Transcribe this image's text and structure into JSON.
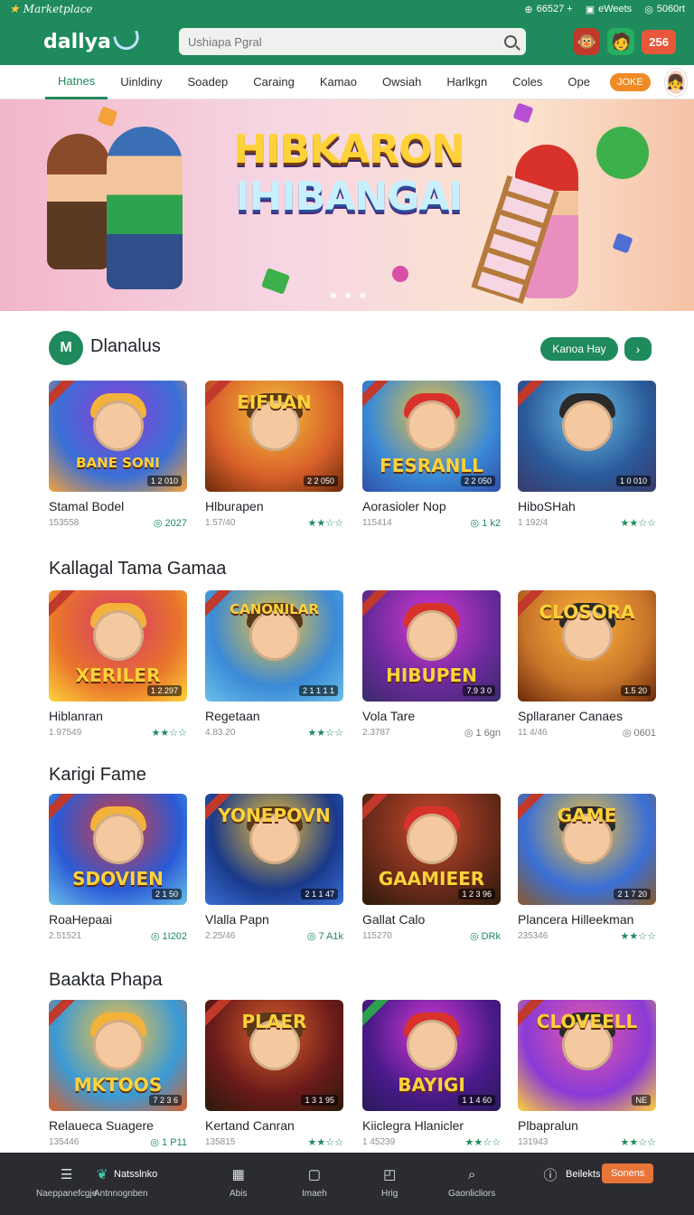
{
  "topstrip": {
    "brand": "Marketplace",
    "stat1": "66527 +",
    "stat2": "eWeets",
    "stat3": "5060rt"
  },
  "header": {
    "logo": "dallya",
    "search_placeholder": "Ushiapa Pgral",
    "coins": "256"
  },
  "nav": {
    "tabs": [
      "Hatnes",
      "Uinldiny",
      "Soadep",
      "Caraing",
      "Kamao",
      "Owsiah",
      "Harlkgn",
      "Coles",
      "Ope"
    ],
    "pill": "JOKE"
  },
  "hero": {
    "title_line1": "HIBKARON",
    "title_line2": "IHIBANGAI"
  },
  "sections": [
    {
      "title": "Dlanalus",
      "icon_text": "M",
      "see_all": "Kanoa Hay",
      "cards": [
        {
          "name": "Stamal Bodel",
          "count": "153558",
          "rating": "2027",
          "badge": "1 2 010",
          "art": "BANE SONI",
          "rating_type": "coin"
        },
        {
          "name": "Hlburapen",
          "count": "1.57/40",
          "rating": "★★☆☆",
          "badge": "2 2 050",
          "art": "EIFUAN",
          "rating_type": "stars"
        },
        {
          "name": "Aorasioler Nop",
          "count": "115414",
          "rating": "1 k2",
          "badge": "2 2 050",
          "art": "FESRANLL",
          "rating_type": "coin"
        },
        {
          "name": "HiboSHah",
          "count": "1 192/4",
          "rating": "★★☆☆",
          "badge": "1 0 010",
          "art": "",
          "rating_type": "stars"
        }
      ]
    },
    {
      "title": "Kallagal Tama Gamaa",
      "cards": [
        {
          "name": "Hiblanran",
          "count": "1.97549",
          "rating": "★★☆☆",
          "badge": "1 2.297",
          "art": "XERILER",
          "rating_type": "stars"
        },
        {
          "name": "Regetaan",
          "count": "4.83.20",
          "rating": "★★☆☆",
          "badge": "2 1 1 1 1",
          "art": "CANONILAR",
          "rating_type": "stars"
        },
        {
          "name": "Vola Tare",
          "count": "2.3787",
          "rating": "1 6gn",
          "badge": "7.9 3 0",
          "art": "HIBUPEN",
          "rating_type": "grey"
        },
        {
          "name": "Spllaraner Canaes",
          "count": "11 4/46",
          "rating": "0601",
          "badge": "1.5 20",
          "art": "CLOSORA",
          "rating_type": "grey"
        }
      ]
    },
    {
      "title": "Karigi Fame",
      "cards": [
        {
          "name": "RoaHepaai",
          "count": "2.51521",
          "rating": "1I202",
          "badge": "2 1 50",
          "art": "SDOVIEN",
          "rating_type": "coin"
        },
        {
          "name": "Vlalla Papn",
          "count": "2.25/46",
          "rating": "7 A1k",
          "badge": "2 1 1 47",
          "art": "YONEPOVN",
          "rating_type": "coin"
        },
        {
          "name": "Gallat Calo",
          "count": "115270",
          "rating": "DRk",
          "badge": "1 2 3 96",
          "art": "GAAMIEER",
          "rating_type": "coin"
        },
        {
          "name": "Plancera Hilleekman",
          "count": "235346",
          "rating": "★★☆☆",
          "badge": "2 1 7 20",
          "art": "GAME",
          "rating_type": "stars"
        }
      ]
    },
    {
      "title": "Baakta Phapa",
      "cards": [
        {
          "name": "Relaueca Suagere",
          "count": "135446",
          "rating": "1 P11",
          "badge": "7 2 3 6",
          "art": "MKTOOS",
          "rating_type": "coin"
        },
        {
          "name": "Kertand Canran",
          "count": "135815",
          "rating": "★★☆☆",
          "badge": "1 3 1 95",
          "art": "PLAER",
          "rating_type": "stars"
        },
        {
          "name": "Kiiclegra Hlanicler",
          "count": "1 45239",
          "rating": "★★☆☆",
          "badge": "1 1 4 60",
          "art": "BAYIGI",
          "rating_type": "stars"
        },
        {
          "name": "Plbapralun",
          "count": "131943",
          "rating": "★★☆☆",
          "badge": "NE",
          "art": "CLOVEELL",
          "rating_type": "stars"
        }
      ]
    }
  ],
  "bottombar": {
    "items": [
      {
        "label": "Naeppanefcgje",
        "icon": "menu-icon"
      },
      {
        "label": "Antnnognben",
        "icon": "leaf-icon",
        "top": "Natsslnko"
      },
      {
        "label": "Abis",
        "icon": "shop-icon"
      },
      {
        "label": "Imaeh",
        "icon": "square-icon"
      },
      {
        "label": "Hrig",
        "icon": "box-icon"
      },
      {
        "label": "Gaonlicliors",
        "icon": "search-icon"
      },
      {
        "label": "Beilekts",
        "icon": "info-icon"
      }
    ],
    "action": "Sonens"
  },
  "colors": {
    "brand_green": "#1f8a5c",
    "accent_orange": "#e8573a",
    "bottom_bar": "#2a2c30"
  }
}
